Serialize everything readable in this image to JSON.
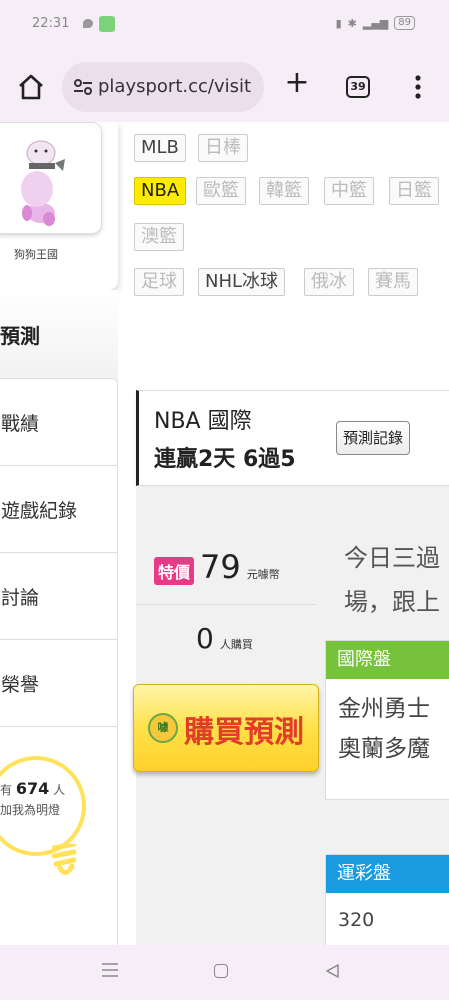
{
  "status_bar": {
    "time": "22:31",
    "battery": "89"
  },
  "url_bar": {
    "url": "playsport.cc/visit",
    "tab_count": "39"
  },
  "sidebar": {
    "avatar_name": "狗狗王國",
    "section_title": "預測",
    "menu": [
      {
        "label": "戰績"
      },
      {
        "label": "遊戲紀錄"
      },
      {
        "label": "討論"
      },
      {
        "label": "榮譽"
      }
    ],
    "fans_prefix": "有",
    "fans_count": "674",
    "fans_unit": "人",
    "fans_suffix": "加我為明燈"
  },
  "league_tags": [
    {
      "label": "MLB",
      "state": "active"
    },
    {
      "label": "日棒",
      "state": "disabled"
    },
    {
      "label": "NBA",
      "state": "current"
    },
    {
      "label": "歐籃",
      "state": "disabled"
    },
    {
      "label": "韓籃",
      "state": "disabled"
    },
    {
      "label": "中籃",
      "state": "disabled"
    },
    {
      "label": "日籃",
      "state": "disabled"
    },
    {
      "label": "澳籃",
      "state": "disabled"
    },
    {
      "label": "足球",
      "state": "disabled"
    },
    {
      "label": "NHL冰球",
      "state": "active"
    },
    {
      "label": "俄冰",
      "state": "disabled"
    },
    {
      "label": "賽馬",
      "state": "disabled"
    }
  ],
  "prediction": {
    "league_name": "NBA 國際",
    "streak": "連贏2天 6過5",
    "history_button": "預測記錄",
    "special_badge": "特價",
    "price": "79",
    "price_unit": "元噱幣",
    "buyers": "0",
    "buyers_unit": "人購買",
    "coin_label": "噱",
    "buy_button": "購買預測",
    "description_line1": "今日三過",
    "description_line2": "場，跟上",
    "intl_panel": {
      "title": "國際盤",
      "team1": "金州勇士",
      "team2": "奧蘭多魔"
    },
    "lottery_panel": {
      "title": "運彩盤",
      "value": "320"
    }
  },
  "colors": {
    "current_tag": "#ffeb00",
    "special_badge": "#e83a86",
    "intl_panel": "#76c23b",
    "lottery_panel": "#1a9be0",
    "buy_text": "#e23d2a"
  }
}
